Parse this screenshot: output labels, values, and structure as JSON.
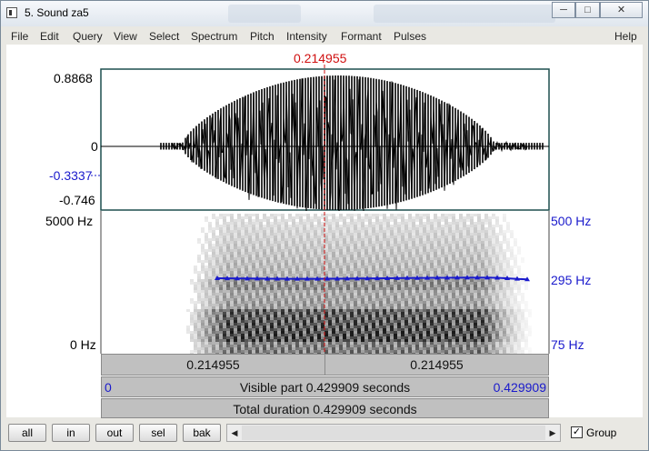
{
  "window": {
    "title": "5. Sound za5"
  },
  "menu": [
    "File",
    "Edit",
    "Query",
    "View",
    "Select",
    "Spectrum",
    "Pitch",
    "Intensity",
    "Formant",
    "Pulses",
    "Help"
  ],
  "cursor": {
    "time": "0.214955"
  },
  "waveform": {
    "max": "0.8868",
    "zero": "0",
    "cursor_value": "-0.3337",
    "min": "-0.746"
  },
  "spectrogram": {
    "top": "5000 Hz",
    "bottom": "0 Hz"
  },
  "pitch": {
    "top": "500 Hz",
    "current": "295 Hz",
    "bottom": "75 Hz"
  },
  "bars": {
    "left_part": "0.214955",
    "right_part": "0.214955",
    "visible_start": "0",
    "visible_label": "Visible part 0.429909 seconds",
    "visible_end": "0.429909",
    "total_label": "Total duration 0.429909 seconds"
  },
  "buttons": {
    "all": "all",
    "in": "in",
    "out": "out",
    "sel": "sel",
    "bak": "bak"
  },
  "group": {
    "label": "Group",
    "checked": true
  },
  "colors": {
    "cursor": "#d01010",
    "pitch": "#1a1acc",
    "values": "#1a1acc"
  }
}
